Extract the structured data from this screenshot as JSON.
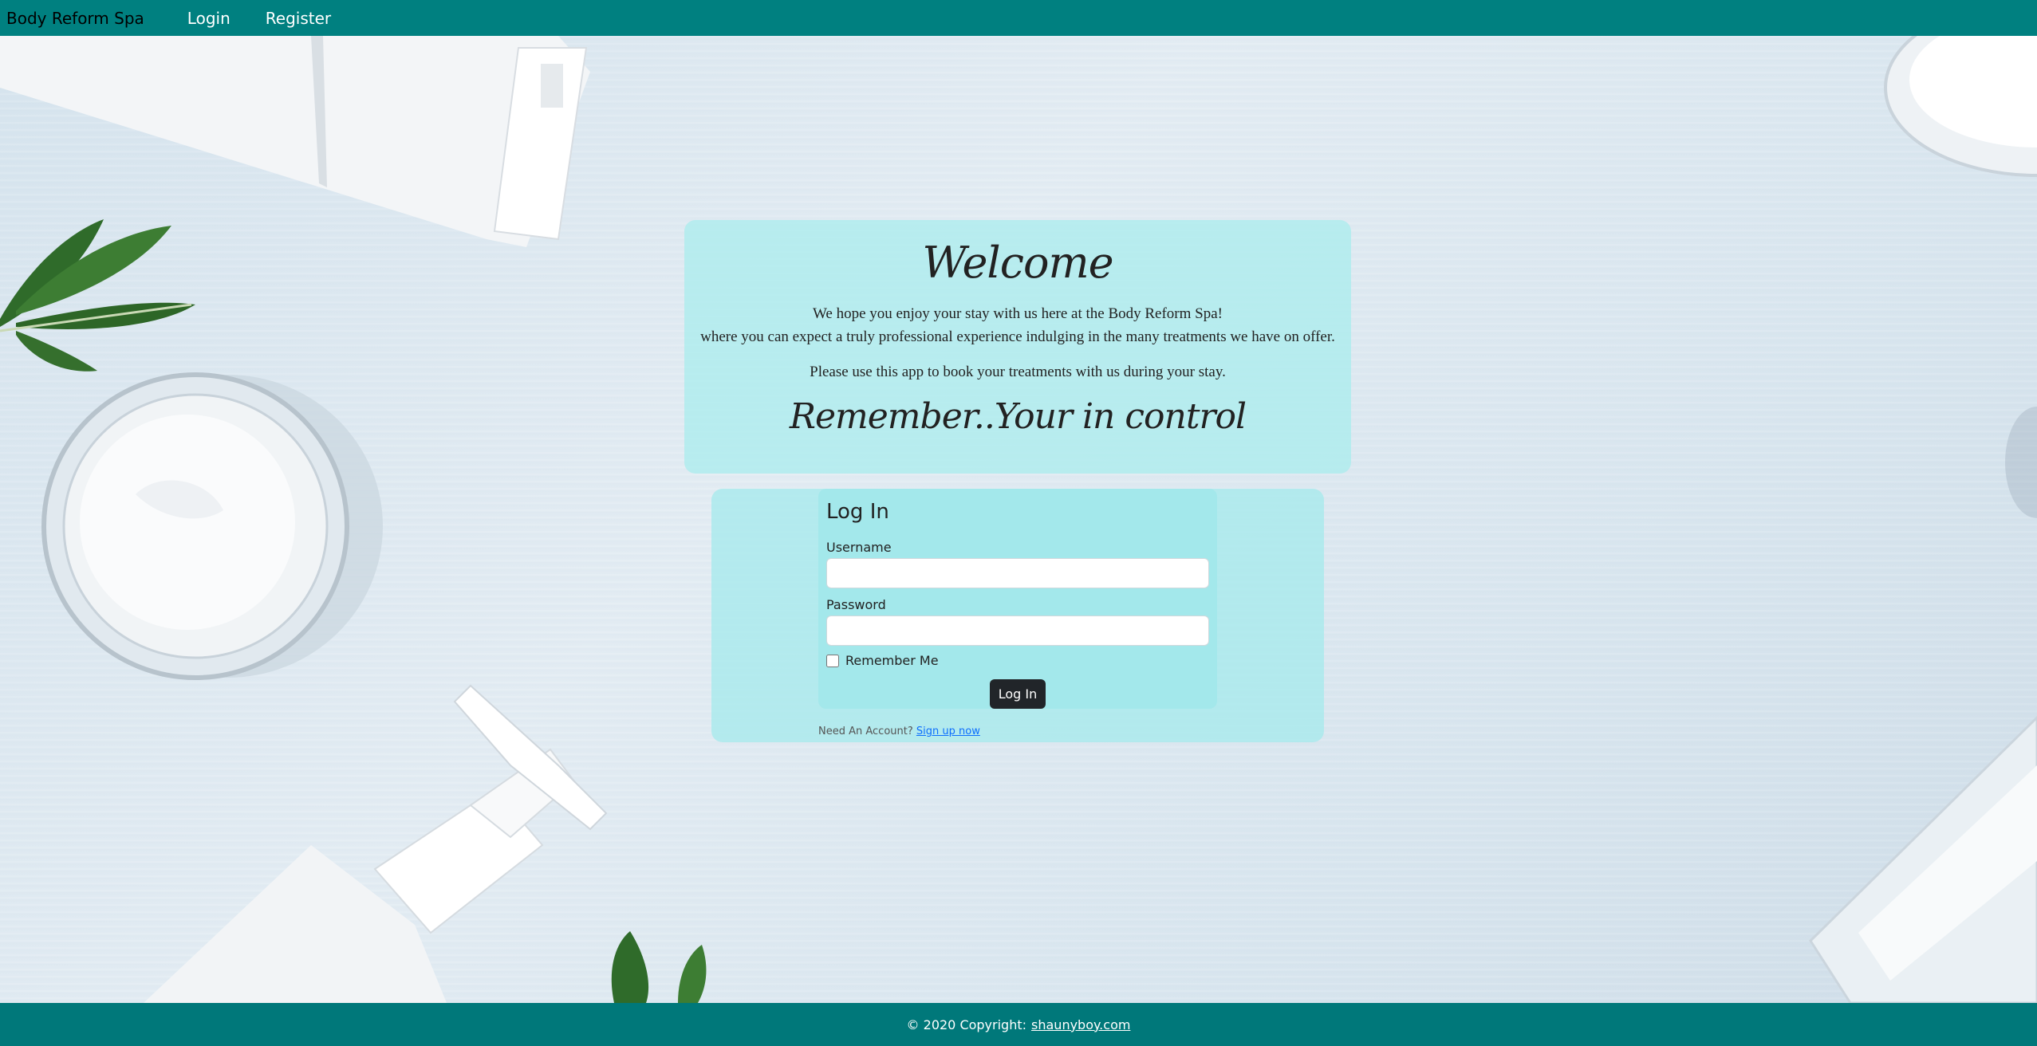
{
  "navbar": {
    "brand": "Body Reform Spa",
    "links": [
      "Login",
      "Register"
    ]
  },
  "welcome": {
    "title": "Welcome",
    "line1": "We hope you enjoy your stay with us here at the Body Reform Spa!",
    "line2": "where you can expect a truly professional experience indulging in the many treatments we have on offer.",
    "line3": "Please use this app to book your treatments with us during your stay.",
    "tagline": "Remember..Your in control"
  },
  "login_form": {
    "heading": "Log In",
    "username_label": "Username",
    "username_value": "",
    "password_label": "Password",
    "password_value": "",
    "remember_label": "Remember Me",
    "remember_checked": false,
    "submit_label": "Log In",
    "signup_prompt": "Need An Account?",
    "signup_link": "Sign up now"
  },
  "footer": {
    "copyright": "© 2020 Copyright:",
    "link": "shaunyboy.com"
  },
  "colors": {
    "navbar": "#008080",
    "footer": "#00787a",
    "card": "#acecee",
    "button": "#212529",
    "link": "#0d6efd"
  }
}
